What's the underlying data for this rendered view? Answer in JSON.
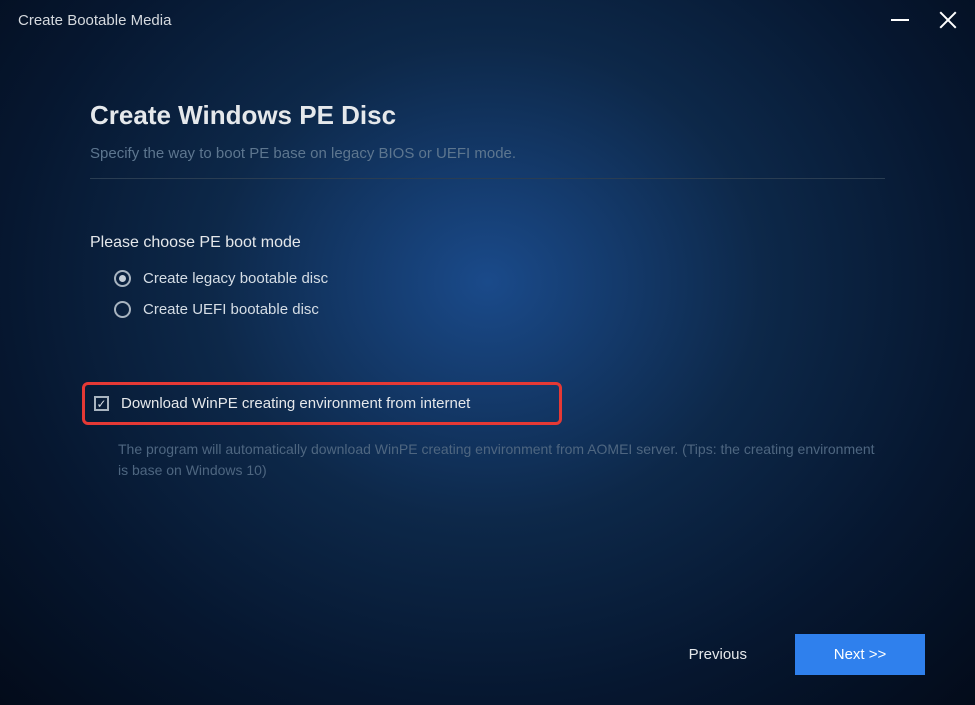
{
  "window": {
    "title": "Create Bootable Media"
  },
  "header": {
    "title": "Create Windows PE Disc",
    "subtitle": "Specify the way to boot PE base on legacy BIOS or UEFI mode."
  },
  "section": {
    "label": "Please choose PE boot mode",
    "options": [
      {
        "label": "Create legacy bootable disc",
        "selected": true
      },
      {
        "label": "Create UEFI bootable disc",
        "selected": false
      }
    ]
  },
  "checkbox": {
    "label": "Download WinPE creating environment from internet",
    "checked": true,
    "hint": "The program will automatically download WinPE creating environment from AOMEI server. (Tips: the creating environment is base on Windows 10)"
  },
  "buttons": {
    "previous": "Previous",
    "next": "Next >>"
  }
}
